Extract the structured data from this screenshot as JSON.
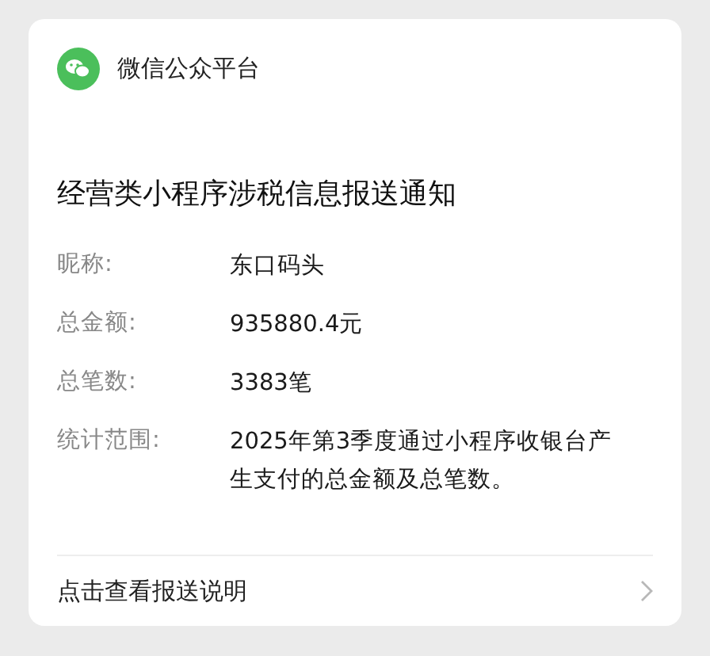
{
  "account": {
    "name": "微信公众平台"
  },
  "title": "经营类小程序涉税信息报送通知",
  "fields": [
    {
      "label": "昵称:",
      "value": "东口码头"
    },
    {
      "label": "总金额:",
      "value": "935880.4元"
    },
    {
      "label": "总笔数:",
      "value": "3383笔"
    },
    {
      "label": "统计范围:",
      "value": "2025年第3季度通过小程序收银台产生支付的总金额及总笔数。"
    }
  ],
  "link": {
    "label": "点击查看报送说明"
  }
}
